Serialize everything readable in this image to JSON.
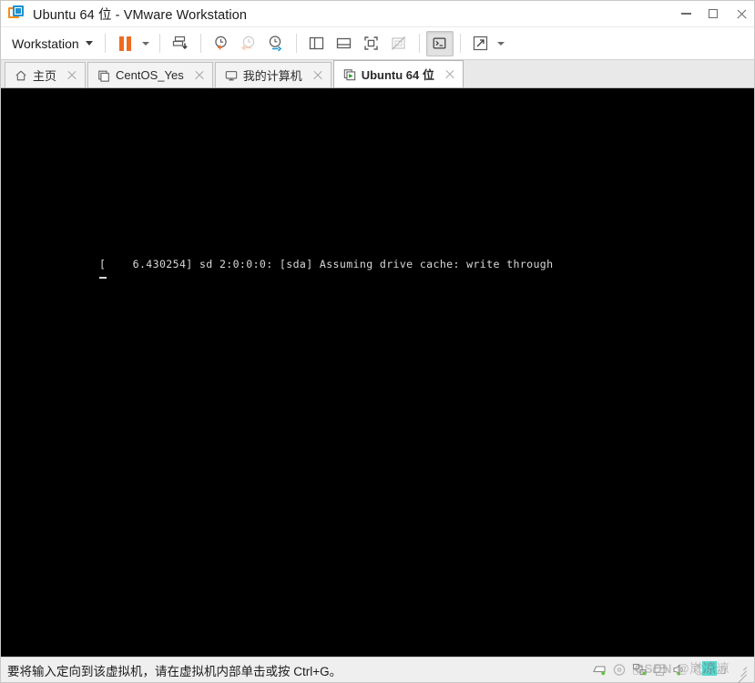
{
  "window": {
    "title": "Ubuntu 64 位 - VMware Workstation",
    "logo_icon": "vmware-logo-icon",
    "controls": {
      "minimize": "minimize-icon",
      "maximize": "maximize-icon",
      "close": "close-icon"
    }
  },
  "toolbar": {
    "workstation_menu_label": "Workstation",
    "items": [
      {
        "name": "suspend-vm-button",
        "icon": "pause-icon",
        "state": "normal"
      },
      {
        "name": "suspend-dropdown",
        "icon": "chevron-down-icon",
        "state": "normal"
      },
      {
        "name": "send-ctrl-alt-del-button",
        "icon": "send-keys-icon",
        "state": "normal"
      },
      {
        "name": "take-snapshot-button",
        "icon": "clock-plus-icon",
        "state": "normal"
      },
      {
        "name": "revert-snapshot-button",
        "icon": "clock-back-arrow-icon",
        "state": "disabled"
      },
      {
        "name": "snapshot-manager-button",
        "icon": "clock-wrench-icon",
        "state": "normal"
      },
      {
        "name": "show-library-button",
        "icon": "library-panel-icon",
        "state": "normal"
      },
      {
        "name": "show-thumbnail-bar-button",
        "icon": "thumbnail-bar-icon",
        "state": "normal"
      },
      {
        "name": "enter-full-screen-button",
        "icon": "full-screen-icon",
        "state": "normal"
      },
      {
        "name": "unity-mode-button",
        "icon": "unity-mode-disabled-icon",
        "state": "disabled"
      },
      {
        "name": "console-view-button",
        "icon": "terminal-prompt-icon",
        "state": "active"
      },
      {
        "name": "stretch-guest-button",
        "icon": "diagonal-arrows-icon",
        "state": "normal"
      },
      {
        "name": "stretch-dropdown",
        "icon": "chevron-down-icon",
        "state": "normal"
      }
    ]
  },
  "tabs": [
    {
      "label": "主页",
      "icon": "home-icon",
      "active": false
    },
    {
      "label": "CentOS_Yes",
      "icon": "vm-box-icon",
      "active": false
    },
    {
      "label": "我的计算机",
      "icon": "monitor-icon",
      "active": false
    },
    {
      "label": "Ubuntu 64 位",
      "icon": "vm-running-icon",
      "active": true
    }
  ],
  "console": {
    "lines": [
      "[    6.430254] sd 2:0:0:0: [sda] Assuming drive cache: write through"
    ],
    "cursor": "_",
    "background": "#000000",
    "foreground": "#d8d8d8"
  },
  "statusbar": {
    "message": "要将输入定向到该虚拟机，请在虚拟机内部单击或按 Ctrl+G。",
    "devices": [
      {
        "name": "hard-disk-icon",
        "connected": true
      },
      {
        "name": "cd-dvd-icon",
        "connected": false
      },
      {
        "name": "network-adapter-icon",
        "connected": true
      },
      {
        "name": "printer-icon",
        "connected": false
      },
      {
        "name": "sound-card-icon",
        "connected": true
      },
      {
        "name": "usb-controller-icon",
        "connected": false
      },
      {
        "name": "removable-device-icon",
        "connected": false
      }
    ],
    "resize_grip": "resize-grip-icon"
  },
  "watermark": {
    "brand": "CSDN",
    "user_prefix": "@岚",
    "user_highlight": "凉",
    "user_suffix": "凉"
  },
  "colors": {
    "accent_orange": "#ef6b21",
    "accent_blue": "#1e92d0",
    "console_bg": "#000000",
    "status_connected": "#6ac04a",
    "chrome_bg": "#efefef",
    "highlight_teal": "#1acdc1"
  }
}
